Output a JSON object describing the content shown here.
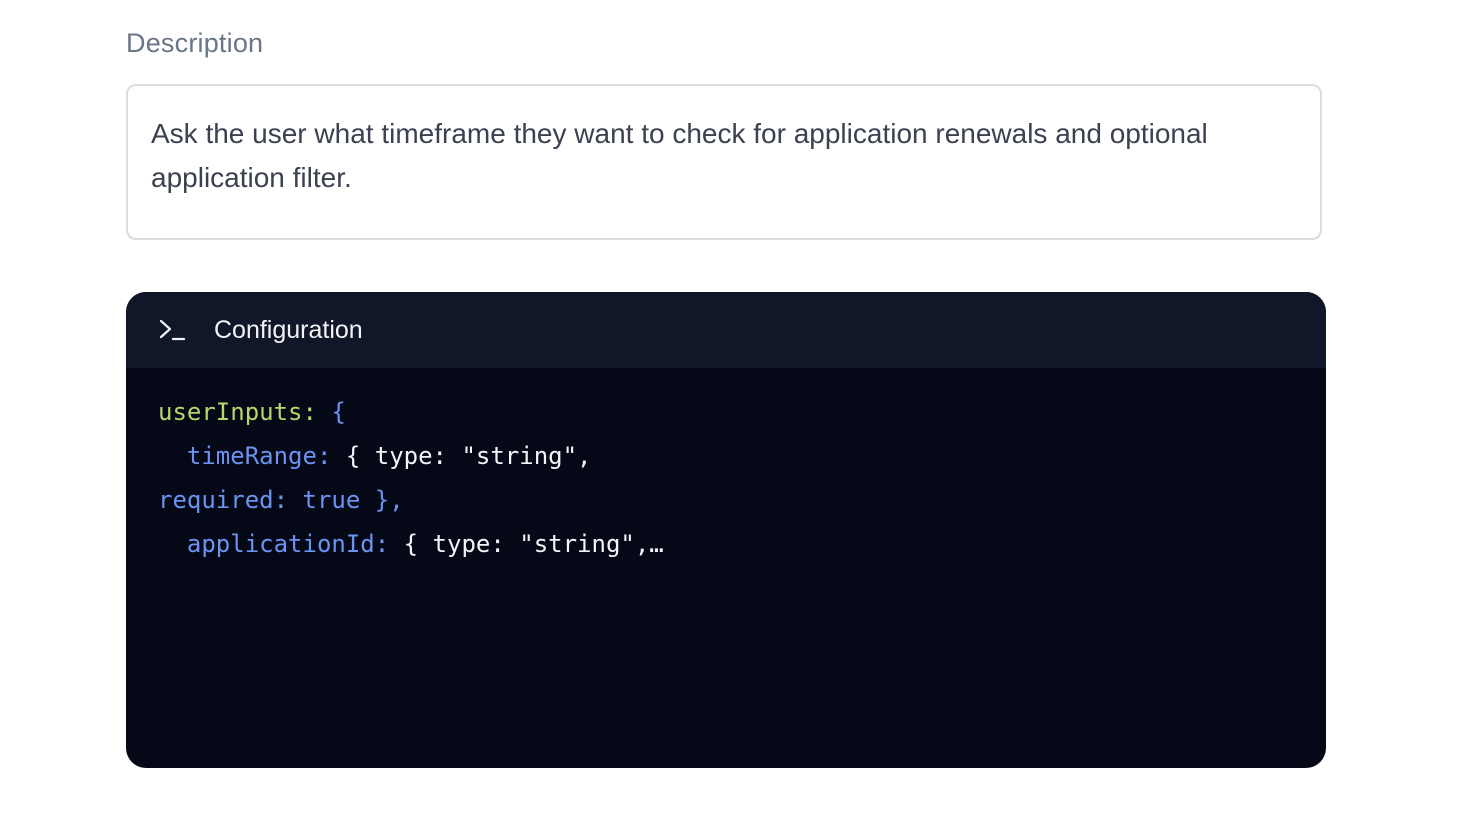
{
  "description": {
    "label": "Description",
    "text": "Ask the user what timeframe they want to check for application renewals and optional application filter."
  },
  "configuration": {
    "title": "Configuration",
    "icon": "terminal-icon",
    "code_lines": [
      {
        "indent": "",
        "tokens": [
          {
            "text": "userInputs:",
            "color": "green"
          },
          {
            "text": " {",
            "color": "blue"
          }
        ]
      },
      {
        "indent": "  ",
        "tokens": [
          {
            "text": "timeRange:",
            "color": "blue"
          },
          {
            "text": " { type: \"string\",",
            "color": "white"
          }
        ]
      },
      {
        "indent": "",
        "tokens": [
          {
            "text": "required: true },",
            "color": "blue"
          }
        ]
      },
      {
        "indent": "  ",
        "tokens": [
          {
            "text": "applicationId:",
            "color": "blue"
          },
          {
            "text": " { type: \"string\",…",
            "color": "white"
          }
        ]
      }
    ]
  },
  "colors": {
    "panel_bg": "#050816",
    "header_bg": "#111729",
    "key_green": "#b5d86a",
    "key_blue": "#6b93f0",
    "text_white": "#f3f5f9"
  }
}
